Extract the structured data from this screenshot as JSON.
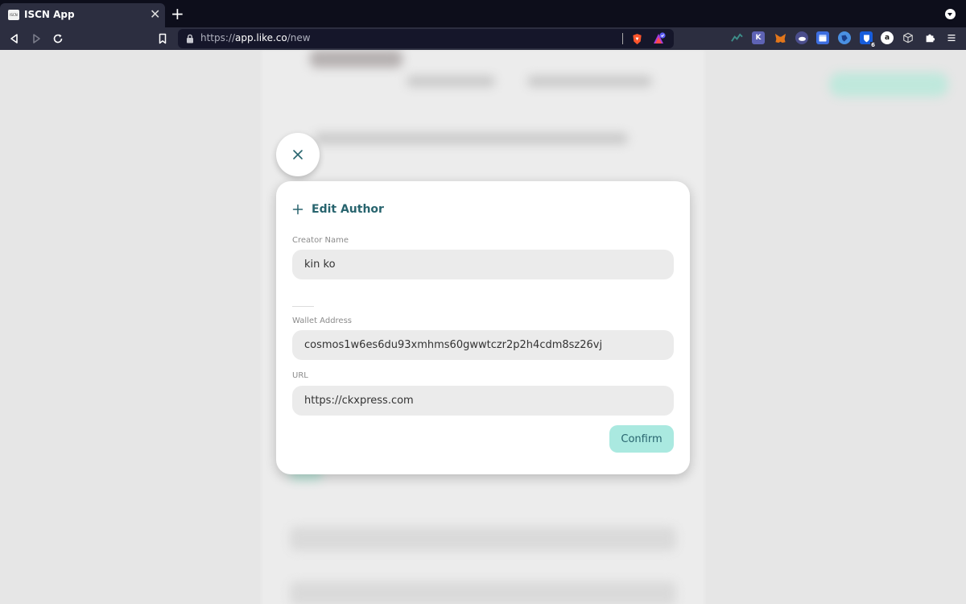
{
  "browser": {
    "tab_title": "ISCN App",
    "favicon_text": "ISCN",
    "url_scheme": "https://",
    "url_host": "app.like.co",
    "url_path": "/new",
    "extension_badge": "6",
    "ext_k_label": "K",
    "ext_a_label": "a"
  },
  "dialog": {
    "title": "Edit Author",
    "creator_name_label": "Creator Name",
    "creator_name_value": "kin ko",
    "wallet_label": "Wallet Address",
    "wallet_value": "cosmos1w6es6du93xmhms60gwwtczr2p2h4cdm8sz26vj",
    "url_label": "URL",
    "url_value": "https://ckxpress.com",
    "confirm_label": "Confirm"
  },
  "colors": {
    "accent": "#28646e",
    "button_bg": "#aae9e0",
    "field_bg": "#ebebeb",
    "browser_dark": "#0d0e1b",
    "browser_toolbar": "#2c2e40"
  }
}
